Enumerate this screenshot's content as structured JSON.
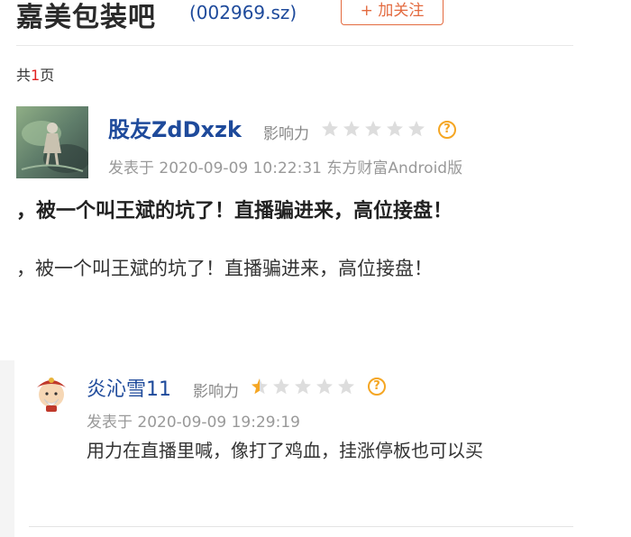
{
  "header": {
    "forum_title": "嘉美包装吧",
    "stock_code": "(002969.sz)",
    "follow_label": "+ 加关注"
  },
  "pagination": {
    "prefix": "共",
    "count": "1",
    "suffix": "页"
  },
  "post": {
    "author": "股友ZdDxzk",
    "influence_label": "影响力",
    "influence_stars": 0,
    "help_symbol": "?",
    "meta": "发表于 2020-09-09 10:22:31 东方财富Android版",
    "title": "，被一个叫王斌的坑了！直播骗进来，高位接盘！",
    "body": "，被一个叫王斌的坑了！直播骗进来，高位接盘！"
  },
  "reply": {
    "author": "炎沁雪11",
    "influence_label": "影响力",
    "influence_stars": 0.5,
    "help_symbol": "?",
    "meta": "发表于 2020-09-09 19:29:19",
    "body": "用力在直播里喊，像打了鸡血，挂涨停板也可以买"
  },
  "colors": {
    "link_blue": "#1e4a9b",
    "accent_orange": "#e36a3f",
    "star_gold": "#f5a623",
    "star_gray": "#dddddd"
  }
}
